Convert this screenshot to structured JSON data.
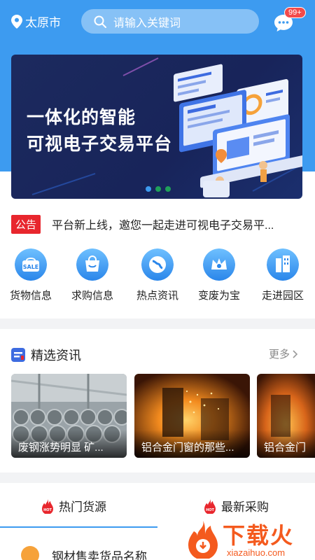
{
  "header": {
    "city": "太原市",
    "search_placeholder": "请输入关键词",
    "message_badge": "99+"
  },
  "banner": {
    "line1": "一体化的智能",
    "line2": "可视电子交易平台",
    "dot_colors": [
      "#3d9bf0",
      "#1fa05a",
      "#1fa05a"
    ]
  },
  "notice": {
    "tag": "公告",
    "text": "平台新上线，邀您一起走进可视电子交易平..."
  },
  "categories": [
    {
      "label": "货物信息",
      "icon": "sale-bag-icon"
    },
    {
      "label": "求购信息",
      "icon": "shopping-bag-icon"
    },
    {
      "label": "热点资讯",
      "icon": "globe-icon"
    },
    {
      "label": "变废为宝",
      "icon": "crown-icon"
    },
    {
      "label": "走进园区",
      "icon": "buildings-icon"
    }
  ],
  "featured": {
    "title": "精选资讯",
    "more": "更多",
    "cards": [
      {
        "caption": "废钢涨势明显 矿..."
      },
      {
        "caption": "铝合金门窗的那些..."
      },
      {
        "caption": "铝合金门"
      }
    ]
  },
  "tabs": {
    "hot_supply": "热门货源",
    "new_purchase": "最新采购",
    "hot_badge": "HOT"
  },
  "list": {
    "first_item": "钢材售卖货品名称"
  },
  "watermark": {
    "brand": "下载火",
    "site": "xiazaihuo.com"
  },
  "colors": {
    "accent": "#3d9bf0",
    "notice_red": "#e8262d",
    "watermark": "#f45a1e"
  }
}
